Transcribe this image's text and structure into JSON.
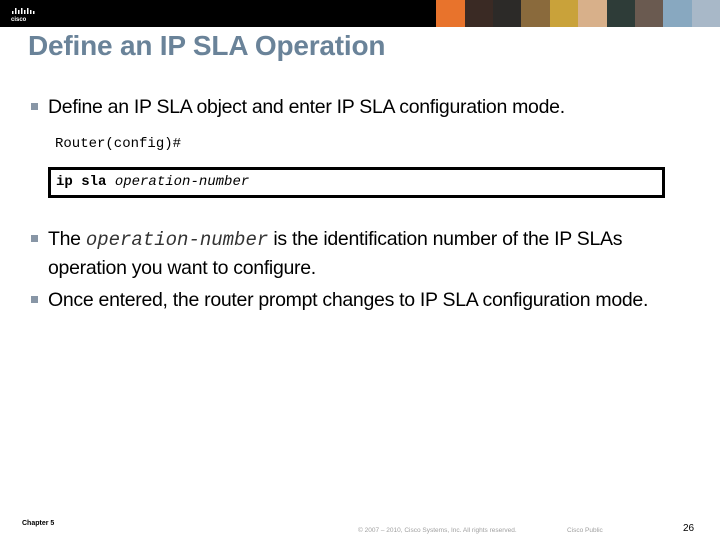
{
  "header": {
    "logo_text": "cisco",
    "photo_colors": [
      "#000000",
      "#e8732c",
      "#3a2a24",
      "#2c2a28",
      "#8a6a3c",
      "#c9a23a",
      "#d8b08a",
      "#2e3c38",
      "#6a5a50",
      "#88a8c0",
      "#a8b8c8"
    ]
  },
  "slide": {
    "title": "Define an IP SLA Operation",
    "bullet1": "Define an IP SLA object and enter IP SLA configuration mode.",
    "prompt": "Router(config)#",
    "command_keyword": "ip sla",
    "command_arg": "operation-number",
    "bullet2_prefix": "The",
    "bullet2_term": "operation-number",
    "bullet2_suffix": "is the identification number of the IP SLAs operation you want to configure.",
    "bullet3": "Once entered, the router prompt changes to IP SLA configuration mode."
  },
  "footer": {
    "chapter": "Chapter 5",
    "copyright": "© 2007 – 2010, Cisco Systems, Inc. All rights reserved.",
    "classification": "Cisco Public",
    "page_number": "26"
  }
}
